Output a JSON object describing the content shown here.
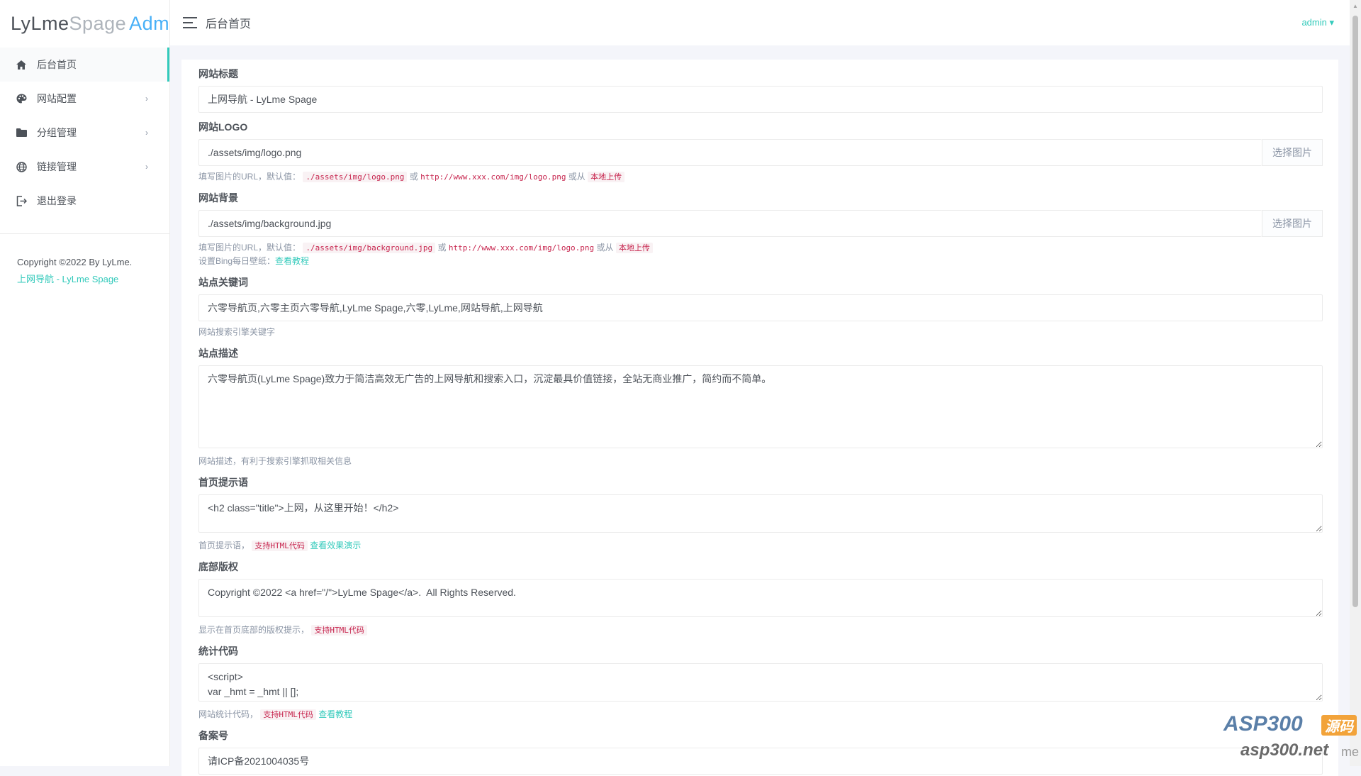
{
  "logo": {
    "part1": "LyLme",
    "part2": "Spage",
    "part3": "Admin"
  },
  "sidebar": {
    "items": [
      {
        "label": "后台首页",
        "icon": "home-icon",
        "active": true
      },
      {
        "label": "网站配置",
        "icon": "palette-icon",
        "arrow": "›"
      },
      {
        "label": "分组管理",
        "icon": "folder-icon",
        "arrow": "›"
      },
      {
        "label": "链接管理",
        "icon": "globe-icon",
        "arrow": "›"
      },
      {
        "label": "退出登录",
        "icon": "logout-icon"
      }
    ],
    "footer": {
      "copyright": "Copyright ©2022 By LyLme.",
      "link": "上网导航 - LyLme Spage"
    }
  },
  "header": {
    "title": "后台首页",
    "user": "admin ▾"
  },
  "form": {
    "title": {
      "label": "网站标题",
      "value": "上网导航 - LyLme Spage"
    },
    "logo": {
      "label": "网站LOGO",
      "value": "./assets/img/logo.png",
      "button": "选择图片",
      "help_prefix": "填写图片的URL，默认值：",
      "code1": "./assets/img/logo.png",
      "or": "或",
      "code2": "http://www.xxx.com/img/logo.png",
      "or_from": "或从",
      "upload": "本地上传"
    },
    "background": {
      "label": "网站背景",
      "value": "./assets/img/background.jpg",
      "button": "选择图片",
      "help_prefix": "填写图片的URL，默认值：",
      "code1": "./assets/img/background.jpg",
      "or": "或",
      "code2": "http://www.xxx.com/img/logo.png",
      "or_from": "或从",
      "upload": "本地上传",
      "bing_prefix": "设置Bing每日壁纸：",
      "bing_link": "查看教程"
    },
    "keywords": {
      "label": "站点关键词",
      "value": "六零导航页,六零主页六零导航,LyLme Spage,六零,LyLme,网站导航,上网导航",
      "help": "网站搜索引擎关键字"
    },
    "description": {
      "label": "站点描述",
      "value": "六零导航页(LyLme Spage)致力于简洁高效无广告的上网导航和搜索入口，沉淀最具价值链接，全站无商业推广，简约而不简单。",
      "help": "网站描述，有利于搜索引擎抓取相关信息"
    },
    "tip": {
      "label": "首页提示语",
      "value": "<h2 class=\"title\">上网，从这里开始！</h2>",
      "help_prefix": "首页提示语，",
      "code": "支持HTML代码",
      "link": "查看效果演示"
    },
    "footer": {
      "label": "底部版权",
      "value": "Copyright ©2022 <a href=\"/\">LyLme Spage</a>.  All Rights Reserved.",
      "help_prefix": "显示在首页底部的版权提示，",
      "code": "支持HTML代码"
    },
    "stats": {
      "label": "统计代码",
      "value": "<script>\nvar _hmt = _hmt || [];",
      "help_prefix": "网站统计代码，",
      "code": "支持HTML代码",
      "link": "查看教程"
    },
    "icp": {
      "label": "备案号",
      "value": "请ICP备2021004035号"
    }
  },
  "watermark": {
    "brand": "ASP300",
    "tag": "源码",
    "site": "asp300.net",
    "suffix": "me"
  }
}
